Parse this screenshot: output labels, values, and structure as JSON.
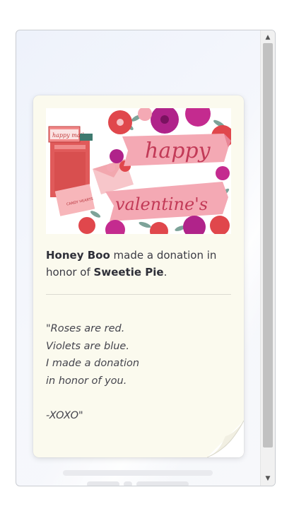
{
  "card": {
    "image": {
      "banner_line1": "happy",
      "banner_line2": "valentine's",
      "mailbox_label": "happy mail",
      "envelope_stamp_text": "CANDY HEARTS"
    },
    "donor_name": "Honey Boo",
    "donation_text_mid": " made a donation in",
    "donation_text_prefix2": "honor of ",
    "honoree_name": "Sweetie Pie",
    "donation_text_end": ".",
    "poem": "\"Roses are red.\nViolets are blue.\nI made a donation\nin honor of you.\n\n-XOXO\""
  },
  "scrollbar": {
    "up_icon": "triangle-up-icon",
    "down_icon": "triangle-down-icon"
  },
  "colors": {
    "card_bg": "#fbfaee",
    "banner_pink": "#f4a9b4",
    "mailbox_red": "#e05a5a",
    "flower_magenta": "#b0238a"
  }
}
